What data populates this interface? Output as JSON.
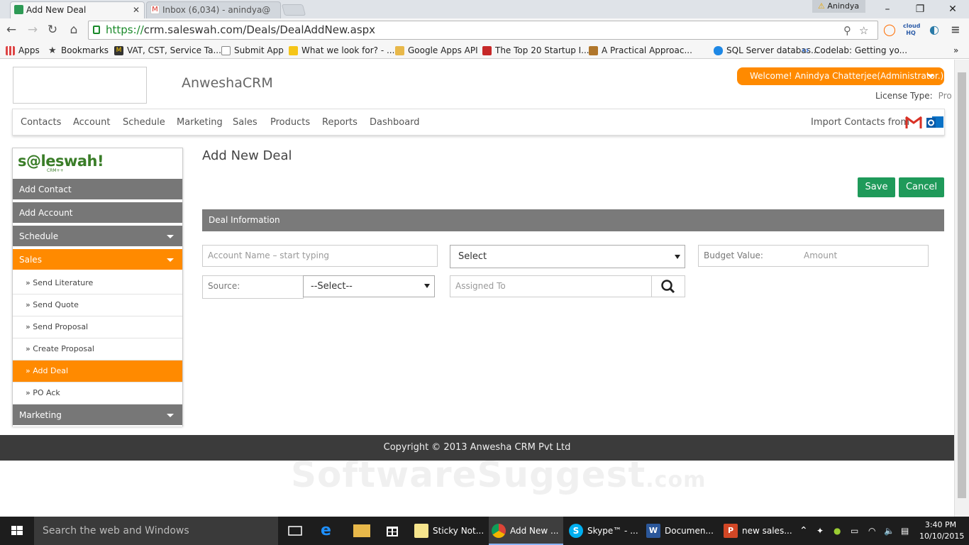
{
  "browser": {
    "tabs": [
      {
        "title": "Add New Deal",
        "active": true
      },
      {
        "title": "Inbox (6,034) - anindya@",
        "active": false
      }
    ],
    "user": "Anindya",
    "url_proto": "https://",
    "url_rest": "crm.saleswah.com/Deals/DealAddNew.aspx",
    "bookmarks": [
      {
        "label": "Apps"
      },
      {
        "label": "Bookmarks"
      },
      {
        "label": "VAT, CST, Service Ta..."
      },
      {
        "label": "Submit App"
      },
      {
        "label": "What we look for? - ..."
      },
      {
        "label": "Google Apps API"
      },
      {
        "label": "The Top 20 Startup I..."
      },
      {
        "label": "A Practical Approac..."
      },
      {
        "label": "SQL Server databas..."
      },
      {
        "label": "Codelab: Getting yo..."
      }
    ]
  },
  "app": {
    "brand": "AnweshaCRM",
    "welcome": "Welcome! Anindya Chatterjee(Administrator.)",
    "license_label": "License Type:",
    "license_value": "Pro",
    "nav": [
      "Contacts",
      "Account",
      "Schedule",
      "Marketing",
      "Sales",
      "Products",
      "Reports",
      "Dashboard"
    ],
    "import_label": "Import Contacts from",
    "sidebar_logo": "s@leswah!",
    "sidebar_logo_sub": "CRM++",
    "sidebar": {
      "add_contact": "Add Contact",
      "add_account": "Add Account",
      "schedule": "Schedule",
      "sales": "Sales",
      "sales_items": [
        "» Send Literature",
        "» Send Quote",
        "» Send Proposal",
        "» Create Proposal",
        "» Add Deal",
        "» PO Ack"
      ],
      "marketing": "Marketing"
    },
    "page_title": "Add New Deal",
    "save": "Save",
    "cancel": "Cancel",
    "section": "Deal Information",
    "form": {
      "account_placeholder": "Account Name – start typing",
      "select_value": "Select",
      "budget_label": "Budget Value:",
      "amount_placeholder": "Amount",
      "source_label": "Source:",
      "source_value": "--Select--",
      "assigned_placeholder": "Assigned To"
    },
    "footer": "Copyright © 2013 Anwesha CRM Pvt Ltd",
    "watermark": "SoftwareSuggest",
    "watermark_suffix": ".com"
  },
  "taskbar": {
    "search": "Search the web and Windows",
    "apps": [
      "Sticky Not...",
      "Add New ...",
      "Skype™ - ...",
      "Documen...",
      "new sales..."
    ],
    "time": "3:40 PM",
    "date": "10/10/2015"
  },
  "colors": {
    "accent": "#ff8a00",
    "save": "#1f9a5a",
    "sidebar_gray": "#777777",
    "footer": "#3b3b3b"
  }
}
